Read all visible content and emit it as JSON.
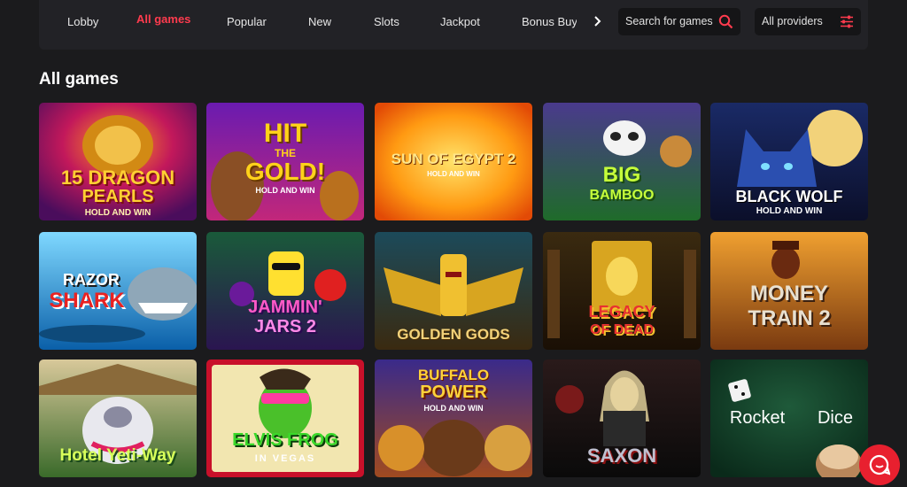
{
  "nav": {
    "items": [
      "Lobby",
      "All games",
      "Popular",
      "New",
      "Slots",
      "Jackpot",
      "Bonus Buy"
    ],
    "active": "All games"
  },
  "search": {
    "placeholder": "Search for games"
  },
  "providers": {
    "label": "All providers"
  },
  "section": {
    "title": "All games"
  },
  "games": [
    {
      "lines": [
        "15 DRAGON",
        "PEARLS",
        "HOLD AND WIN"
      ]
    },
    {
      "lines": [
        "HIT",
        "THE",
        "GOLD!",
        "HOLD AND WIN"
      ]
    },
    {
      "lines": [
        "SUN OF EGYPT 2",
        "HOLD AND WIN"
      ]
    },
    {
      "lines": [
        "BIG",
        "BAMBOO"
      ]
    },
    {
      "lines": [
        "BLACK WOLF",
        "HOLD AND WIN"
      ]
    },
    {
      "lines": [
        "RAZOR",
        "SHARK"
      ]
    },
    {
      "lines": [
        "JAMMIN'",
        "JARS 2"
      ]
    },
    {
      "lines": [
        "GOLDEN GODS"
      ]
    },
    {
      "lines": [
        "LEGACY",
        "OF DEAD"
      ]
    },
    {
      "lines": [
        "MONEY",
        "TRAIN 2"
      ]
    },
    {
      "lines": [
        "Hotel Yeti-Way"
      ]
    },
    {
      "lines": [
        "ELVIS FROG",
        "IN VEGAS"
      ]
    },
    {
      "lines": [
        "BUFFALO",
        "POWER",
        "HOLD AND WIN"
      ]
    },
    {
      "lines": [
        "SAXON"
      ]
    },
    {
      "lines": [
        "Rocket",
        "Dice"
      ]
    }
  ],
  "colors": {
    "accent": "#ff3b4e",
    "background": "#1b1b1d",
    "bar": "#222226"
  },
  "icons": {
    "search": "search-icon",
    "filter": "filter-icon",
    "arrow": "chevron-right-icon",
    "chat": "chat-icon"
  }
}
